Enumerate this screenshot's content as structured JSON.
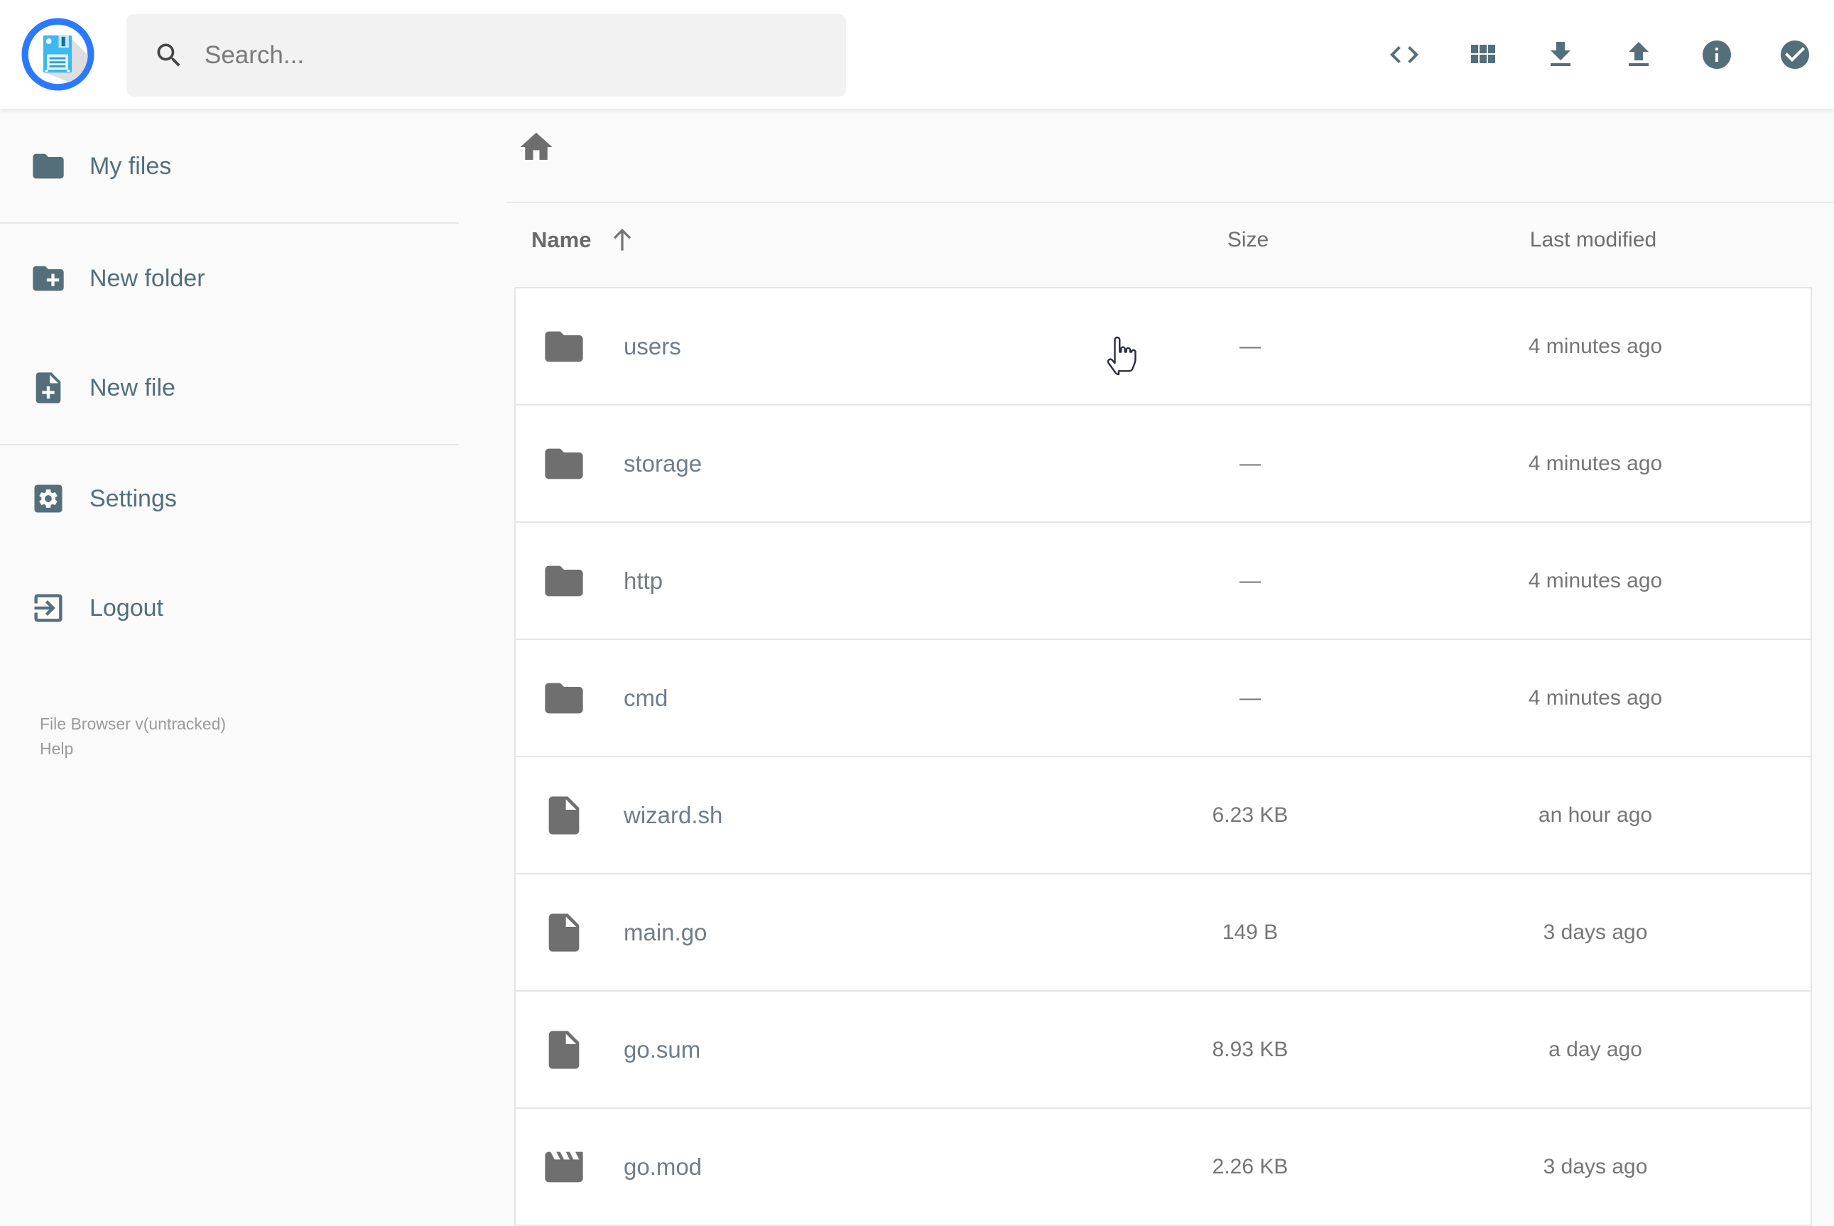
{
  "colors": {
    "accent_blue": "#2a79ff",
    "floppy_blue": "#3cb9f1",
    "slate": "#546e7a",
    "page_background": "#fafafa",
    "row_background": "#ffffff"
  },
  "header": {
    "logo_icon": "floppy-disk-logo",
    "search": {
      "placeholder": "Search...",
      "icon": "search-icon",
      "value": ""
    },
    "action_icons": [
      "shell-code",
      "switch-view-grid",
      "download",
      "upload",
      "info",
      "select-multiple-check"
    ]
  },
  "sidebar": {
    "items": [
      {
        "label": "My files",
        "icon": "folder-icon"
      },
      {
        "label": "New folder",
        "icon": "create-new-folder-icon"
      },
      {
        "label": "New file",
        "icon": "new-file-icon"
      },
      {
        "label": "Settings",
        "icon": "settings-icon"
      },
      {
        "label": "Logout",
        "icon": "logout-icon"
      }
    ],
    "footer": {
      "version": "File Browser v(untracked)",
      "help": "Help"
    }
  },
  "listing": {
    "breadcrumb": {
      "home_icon": "home-icon"
    },
    "columns": {
      "name": "Name",
      "size": "Size",
      "modified": "Last modified"
    },
    "sort": {
      "column": "name",
      "direction": "ascending",
      "icon": "arrow-up-icon"
    },
    "rows": [
      {
        "name": "users",
        "type": "folder",
        "size": "—",
        "modified": "4 minutes ago"
      },
      {
        "name": "storage",
        "type": "folder",
        "size": "—",
        "modified": "4 minutes ago"
      },
      {
        "name": "http",
        "type": "folder",
        "size": "—",
        "modified": "4 minutes ago"
      },
      {
        "name": "cmd",
        "type": "folder",
        "size": "—",
        "modified": "4 minutes ago"
      },
      {
        "name": "wizard.sh",
        "type": "file",
        "size": "6.23 KB",
        "modified": "an hour ago"
      },
      {
        "name": "main.go",
        "type": "file",
        "size": "149 B",
        "modified": "3 days ago"
      },
      {
        "name": "go.sum",
        "type": "file",
        "size": "8.93 KB",
        "modified": "a day ago"
      },
      {
        "name": "go.mod",
        "type": "movie",
        "size": "2.26 KB",
        "modified": "3 days ago"
      }
    ]
  }
}
